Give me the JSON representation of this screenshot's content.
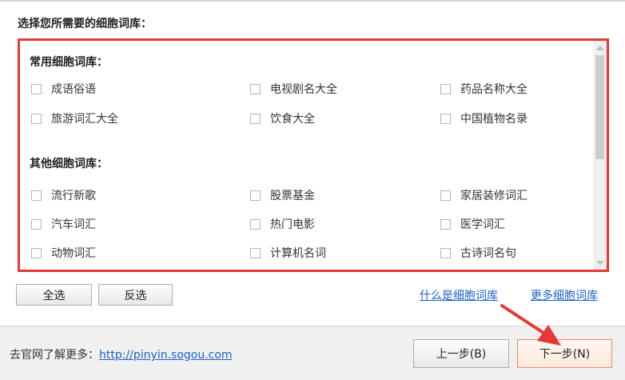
{
  "prompt": "选择您所需要的细胞词库：",
  "sections": [
    {
      "title": "常用细胞词库：",
      "items": [
        "成语俗语",
        "电视剧名大全",
        "药品名称大全",
        "旅游词汇大全",
        "饮食大全",
        "中国植物名录"
      ]
    },
    {
      "title": "其他细胞词库：",
      "items": [
        "流行新歌",
        "股票基金",
        "家居装修词汇",
        "汽车词汇",
        "热门电影",
        "医学词汇",
        "动物词汇",
        "计算机名词",
        "古诗词名句"
      ]
    }
  ],
  "buttons": {
    "select_all": "全选",
    "invert": "反选",
    "prev": "上一步(B)",
    "next": "下一步(N)"
  },
  "links": {
    "what_is": "什么是细胞词库",
    "more": "更多细胞词库"
  },
  "footer": {
    "label": "去官网了解更多：",
    "url": "http://pinyin.sogou.com"
  },
  "colors": {
    "highlight_border": "#e53935",
    "arrow": "#e53935",
    "link": "#1a62c9"
  },
  "icons": [
    "checkbox",
    "scroll-up-arrow",
    "scroll-down-arrow",
    "pointer-arrow"
  ]
}
